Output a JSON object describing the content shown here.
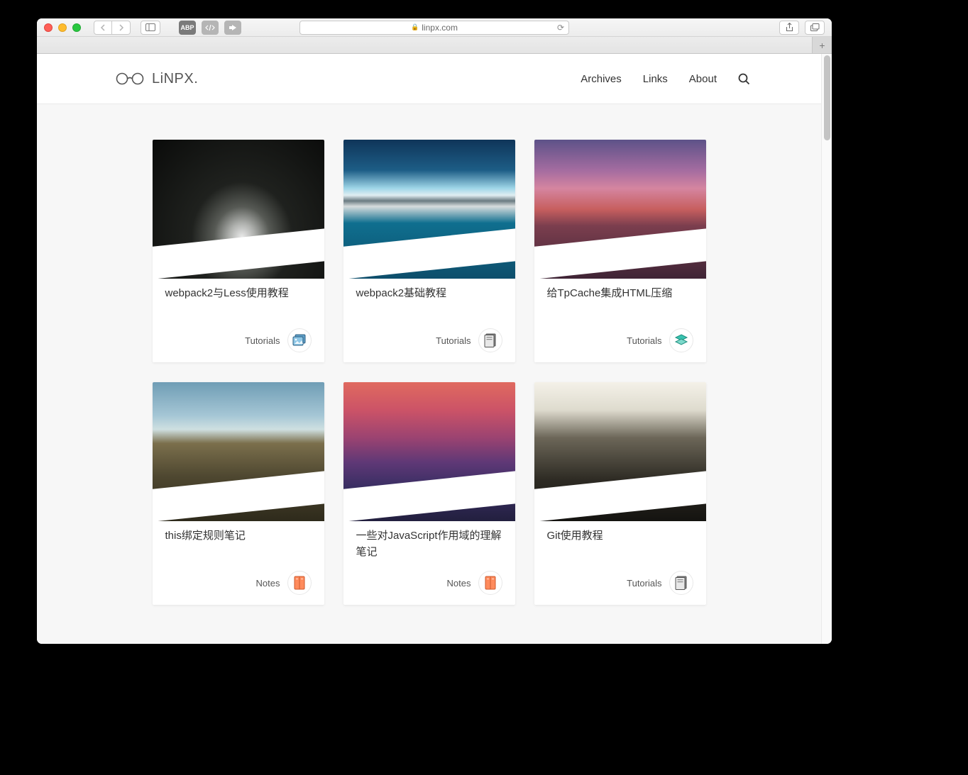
{
  "browser": {
    "url_display": "linpx.com"
  },
  "header": {
    "logo_text": "LiNPX.",
    "nav": [
      {
        "label": "Archives"
      },
      {
        "label": "Links"
      },
      {
        "label": "About"
      }
    ]
  },
  "cards": [
    {
      "title": "webpack2与Less使用教程",
      "category": "Tutorials",
      "badge": "gallery",
      "image": "img-waterfall"
    },
    {
      "title": "webpack2基础教程",
      "category": "Tutorials",
      "badge": "book-gray",
      "image": "img-mountains"
    },
    {
      "title": "给TpCache集成HTML压缩",
      "category": "Tutorials",
      "badge": "layers",
      "image": "img-desert"
    },
    {
      "title": "this绑定规则笔记",
      "category": "Notes",
      "badge": "book-orange",
      "image": "img-canyon"
    },
    {
      "title": "一些对JavaScript作用域的理解笔记",
      "category": "Notes",
      "badge": "book-orange",
      "image": "img-city"
    },
    {
      "title": "Git使用教程",
      "category": "Tutorials",
      "badge": "book-gray",
      "image": "img-climber"
    }
  ]
}
